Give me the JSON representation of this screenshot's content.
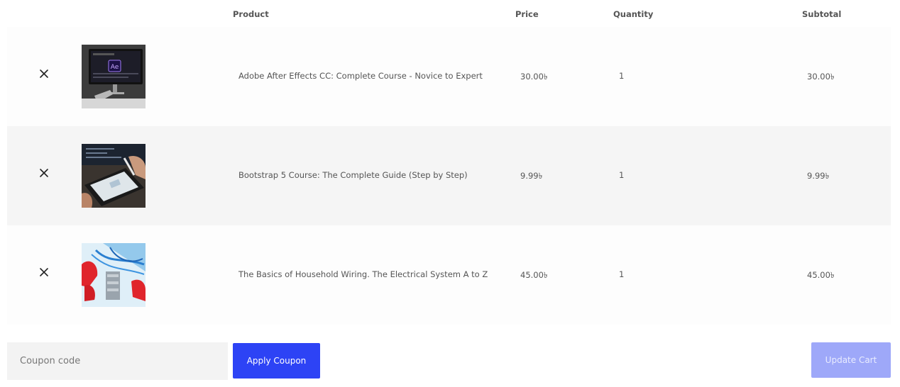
{
  "table": {
    "headers": {
      "product": "Product",
      "price": "Price",
      "quantity": "Quantity",
      "subtotal": "Subtotal"
    },
    "rows": [
      {
        "name": "Adobe After Effects CC: Complete Course - Novice to Expert",
        "price": "30.00৳",
        "quantity": "1",
        "subtotal": "30.00৳",
        "thumb_icon": "monitor-after-effects-icon"
      },
      {
        "name": "Bootstrap 5 Course: The Complete Guide (Step by Step)",
        "price": "9.99৳",
        "quantity": "1",
        "subtotal": "9.99৳",
        "thumb_icon": "tablet-stylus-icon"
      },
      {
        "name": "The Basics of Household Wiring. The Electrical System A to Z",
        "price": "45.00৳",
        "quantity": "1",
        "subtotal": "45.00৳",
        "thumb_icon": "electrical-wiring-icon"
      }
    ],
    "remove_icon": "close-icon",
    "ae_badge": "Ae"
  },
  "actions": {
    "coupon_placeholder": "Coupon code",
    "apply_label": "Apply Coupon",
    "update_label": "Update Cart"
  },
  "colors": {
    "primary": "#2d43f5",
    "primary_disabled": "#9ea8f9",
    "row_alt": "#f5f5f5",
    "input_bg": "#f3f3f3"
  }
}
